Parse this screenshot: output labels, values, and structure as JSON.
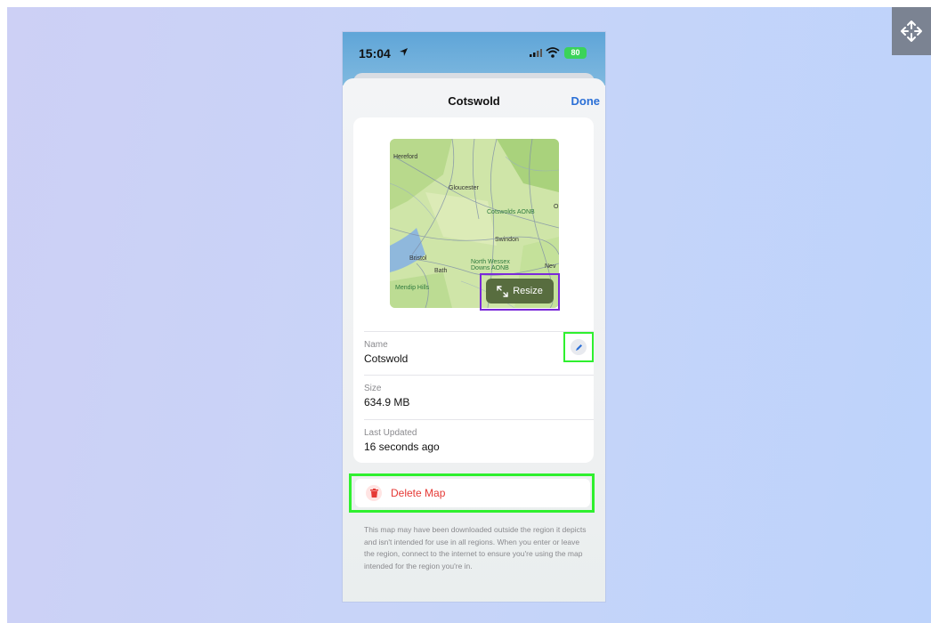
{
  "status_bar": {
    "time": "15:04",
    "battery": "80"
  },
  "sheet": {
    "title": "Cotswold",
    "done_label": "Done"
  },
  "map_preview": {
    "labels": [
      "Hereford",
      "Gloucester",
      "Cotswolds AONB",
      "Swindon",
      "Bristol",
      "Bath",
      "North Wessex Downs AONB",
      "Mendip Hills",
      "Nev",
      "O"
    ],
    "resize_label": "Resize"
  },
  "details": {
    "name_label": "Name",
    "name_value": "Cotswold",
    "size_label": "Size",
    "size_value": "634.9 MB",
    "updated_label": "Last Updated",
    "updated_value": "16 seconds ago"
  },
  "delete": {
    "label": "Delete Map"
  },
  "disclaimer": "This map may have been downloaded outside the region it depicts and isn't intended for use in all regions. When you enter or leave the region, connect to the internet to ensure you're using the map intended for the region you're in.",
  "colors": {
    "accent": "#2a6fd6",
    "destructive": "#e53935",
    "resize_button": "#586d3f",
    "highlight_green": "#2ff02f",
    "highlight_purple": "#7b2ad9"
  },
  "icons": [
    "location-arrow-icon",
    "signal-icon",
    "wifi-icon",
    "battery-icon",
    "resize-arrows-icon",
    "pencil-icon",
    "trash-icon",
    "move-arrows-icon"
  ]
}
